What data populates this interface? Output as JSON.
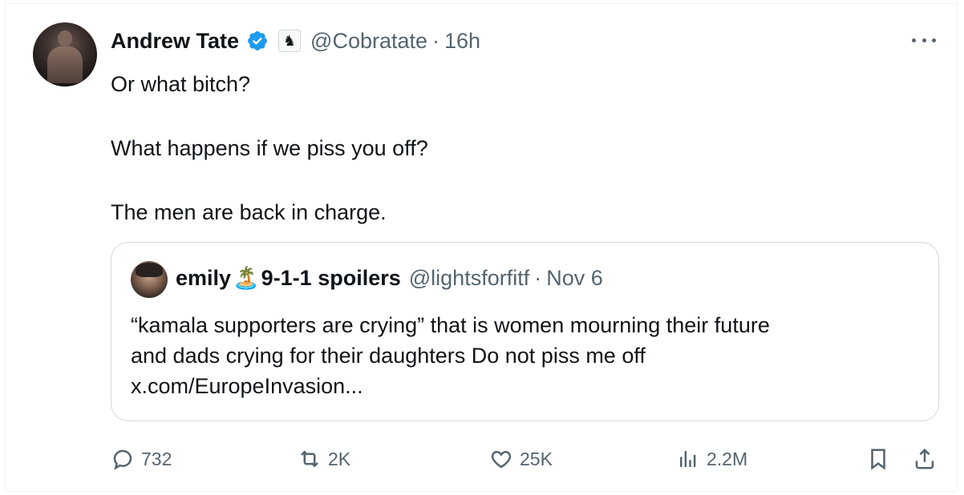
{
  "tweet": {
    "author_name": "Andrew Tate",
    "handle": "@Cobratate",
    "separator": "·",
    "time": "16h",
    "lines": [
      "Or what bitch?",
      "What happens if we piss you off?",
      "The men are back in charge."
    ]
  },
  "quote": {
    "name_part1": "emily",
    "emoji": "🏝️",
    "name_part2": "9-1-1 spoilers",
    "handle": "@lightsforfitf",
    "separator": "·",
    "date": "Nov 6",
    "text_lines": [
      "“kamala supporters are crying” that is women mourning their future",
      "and dads crying for their daughters Do not piss me off",
      "x.com/EuropeInvasion..."
    ]
  },
  "actions": {
    "replies": "732",
    "retweets": "2K",
    "likes": "25K",
    "views": "2.2M"
  },
  "colors": {
    "text": "#0f1419",
    "muted": "#536471",
    "verified": "#1d9bf0",
    "border": "#cfd9de"
  },
  "icons": [
    "more-icon",
    "verified-badge-icon",
    "affiliate-badge-icon",
    "reply-icon",
    "retweet-icon",
    "like-icon",
    "views-icon",
    "bookmark-icon",
    "share-icon"
  ]
}
